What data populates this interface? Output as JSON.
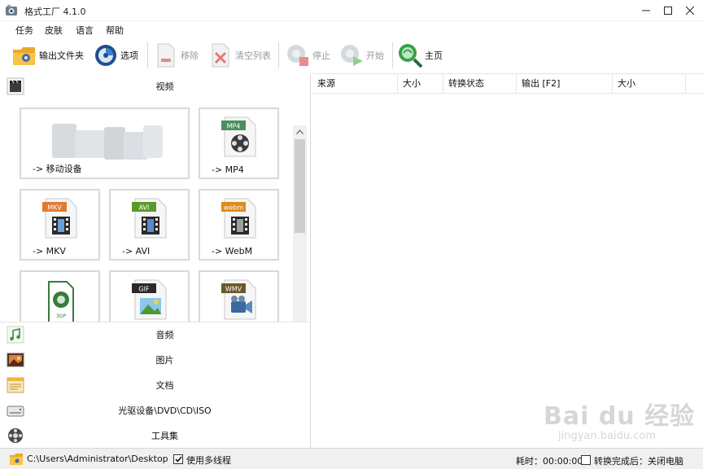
{
  "window": {
    "title": "格式工厂 4.1.0",
    "app_icon": "format-factory-icon",
    "minimize_icon": "minimize-icon",
    "maximize_icon": "maximize-icon",
    "close_icon": "close-icon"
  },
  "menu": [
    "任务",
    "皮肤",
    "语言",
    "帮助"
  ],
  "toolbar": {
    "output_folder": "输出文件夹",
    "options": "选项",
    "remove": "移除",
    "clear_list": "清空列表",
    "stop": "停止",
    "start": "开始",
    "home": "主页"
  },
  "categories": {
    "video": "视频",
    "audio": "音频",
    "picture": "图片",
    "document": "文档",
    "optical": "光驱设备\\DVD\\CD\\ISO",
    "tools": "工具集"
  },
  "video_tiles": [
    {
      "label": "-> 移动设备",
      "badge": ""
    },
    {
      "label": "-> MP4",
      "badge": "MP4"
    },
    {
      "label": "-> MKV",
      "badge": "MKV"
    },
    {
      "label": "-> AVI",
      "badge": "AVI"
    },
    {
      "label": "-> WebM",
      "badge": "webm"
    },
    {
      "label": "",
      "badge": "3GP"
    },
    {
      "label": "",
      "badge": "GIF"
    },
    {
      "label": "",
      "badge": "WMV"
    }
  ],
  "table": {
    "columns": [
      "来源",
      "大小",
      "转换状态",
      "输出 [F2]",
      "大小"
    ]
  },
  "status": {
    "output_path": "C:\\Users\\Administrator\\Desktop",
    "multithread_label": "使用多线程",
    "multithread_checked": true,
    "elapsed_label": "耗时：00:00:00",
    "after_convert_label": "转换完成后：关闭电脑",
    "after_convert_checked": false
  },
  "watermark": {
    "brand": "Bai du 经验",
    "url": "jingyan.baidu.com"
  },
  "colors": {
    "mp4_badge": "#4a8f5c",
    "mkv_badge": "#e07a2f",
    "avi_badge": "#5a9a2a",
    "webm_badge": "#e08a1a",
    "gif_badge": "#2a2a2a",
    "wmv_badge": "#6a5a2a",
    "gp_badge": "#3a7a3a",
    "home_green": "#3aa04a"
  }
}
